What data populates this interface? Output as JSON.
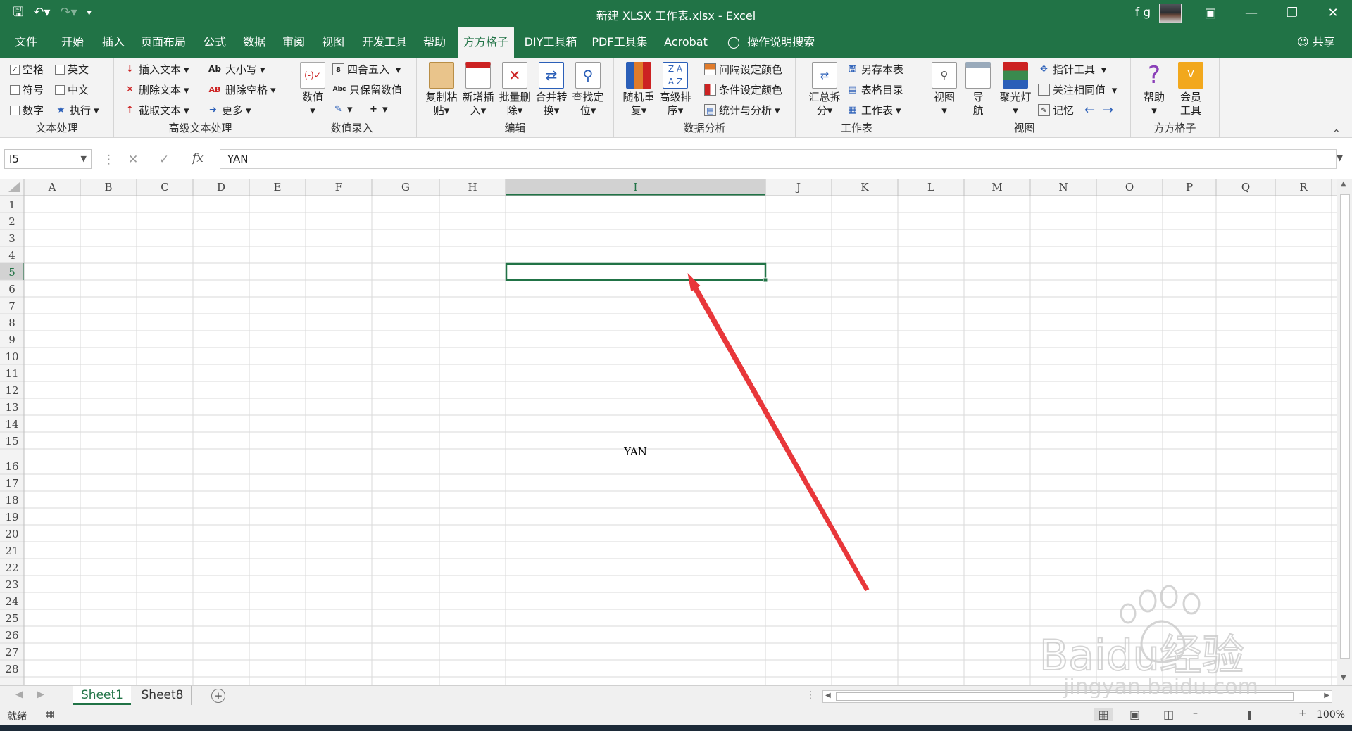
{
  "window": {
    "title": "新建 XLSX 工作表.xlsx  -  Excel",
    "user": "f g"
  },
  "menu": {
    "tabs": [
      "文件",
      "开始",
      "插入",
      "页面布局",
      "公式",
      "数据",
      "审阅",
      "视图",
      "开发工具",
      "帮助",
      "方方格子",
      "DIY工具箱",
      "PDF工具集",
      "Acrobat"
    ],
    "active_tab": "方方格子",
    "search": "操作说明搜索",
    "share": "共享"
  },
  "ribbon": {
    "text": {
      "label": "文本处理",
      "items": [
        "空格",
        "英文",
        "符号",
        "中文",
        "数字",
        "执行"
      ]
    },
    "adv_text": {
      "label": "高级文本处理",
      "items": [
        "插入文本",
        "删除文本",
        "截取文本",
        "大小写",
        "删除空格",
        "更多"
      ]
    },
    "num_input": {
      "label": "数值录入",
      "items": [
        "数值",
        "四舍五入",
        "只保留数值"
      ]
    },
    "edit": {
      "label": "编辑",
      "items": [
        "复制粘贴",
        "新增插入",
        "批量删除",
        "合并转换",
        "查找定位"
      ]
    },
    "analysis": {
      "label": "数据分析",
      "items": [
        "随机重复",
        "高级排序",
        "间隔设定颜色",
        "条件设定颜色",
        "统计与分析"
      ]
    },
    "sheet": {
      "label": "工作表",
      "items": [
        "汇总拆分",
        "另存本表",
        "表格目录",
        "工作表"
      ]
    },
    "view": {
      "label": "视图",
      "items": [
        "视图",
        "导航",
        "聚光灯",
        "指针工具",
        "关注相同值",
        "记忆"
      ]
    },
    "ffgz": {
      "label": "方方格子",
      "items": [
        "帮助",
        "会员工具"
      ]
    }
  },
  "formula_bar": {
    "name_box": "I5",
    "value": "YAN"
  },
  "grid": {
    "columns": [
      "A",
      "B",
      "C",
      "D",
      "E",
      "F",
      "G",
      "H",
      "I",
      "J",
      "K",
      "L",
      "M",
      "N",
      "O",
      "P",
      "Q",
      "R"
    ],
    "rows": [
      "1",
      "2",
      "3",
      "4",
      "5",
      "6",
      "7",
      "8",
      "9",
      "10",
      "11",
      "12",
      "13",
      "14",
      "15",
      "16",
      "17",
      "18",
      "19",
      "20",
      "21",
      "22",
      "23",
      "24",
      "25",
      "26",
      "27",
      "28"
    ],
    "active_cell": "I5",
    "active_value": "YAN"
  },
  "sheets": {
    "tabs": [
      "Sheet1",
      "Sheet8"
    ],
    "active": "Sheet1"
  },
  "status": {
    "ready": "就绪",
    "zoom": "100%"
  },
  "watermark": {
    "brand": "Baidu经验",
    "url": "jingyan.baidu.com"
  },
  "colors": {
    "accent": "#217346",
    "annotation_arrow": "#e8373a"
  }
}
